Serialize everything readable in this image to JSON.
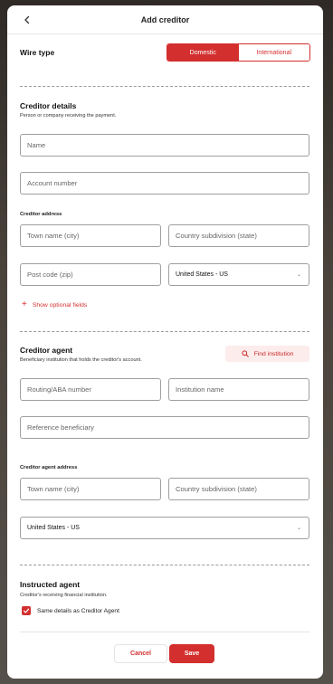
{
  "header": {
    "title": "Add creditor"
  },
  "wire_type": {
    "label": "Wire type",
    "options": [
      "Domestic",
      "International"
    ],
    "selected": "Domestic"
  },
  "creditor_details": {
    "title": "Creditor details",
    "subtitle": "Person or company receiving the payment.",
    "name_placeholder": "Name",
    "account_placeholder": "Account number",
    "address_label": "Creditor address",
    "town_placeholder": "Town name (city)",
    "state_placeholder": "Country subdivision (state)",
    "zip_placeholder": "Post code (zip)",
    "country_value": "United States - US",
    "optional_link": "Show optional fields"
  },
  "creditor_agent": {
    "title": "Creditor agent",
    "subtitle": "Beneficiary institution that holds the creditor's account.",
    "find_button": "Find institution",
    "routing_placeholder": "Routing/ABA number",
    "institution_placeholder": "Institution name",
    "reference_placeholder": "Reference beneficiary",
    "address_label": "Creditor agent address",
    "town_placeholder": "Town name (city)",
    "state_placeholder": "Country subdivision (state)",
    "country_value": "United States - US"
  },
  "instructed_agent": {
    "title": "Instructed agent",
    "subtitle": "Creditor's receiving financial institution.",
    "same_details_label": "Same details as Creditor Agent",
    "same_details_checked": true
  },
  "footer": {
    "cancel_label": "Cancel",
    "save_label": "Save"
  },
  "colors": {
    "accent": "#d32f2f"
  },
  "icons": {
    "back": "chevron-left-icon",
    "plus": "plus-icon",
    "search": "search-icon",
    "dropdown": "chevron-down-icon",
    "check": "check-icon"
  }
}
